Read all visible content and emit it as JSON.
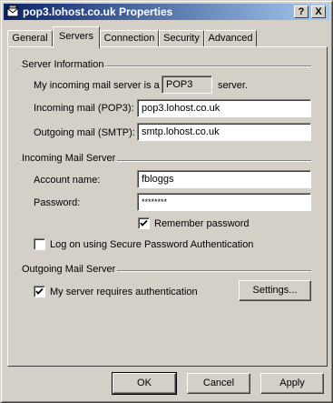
{
  "window": {
    "title": "pop3.lohost.co.uk Properties",
    "help_btn": "?",
    "close_btn": "X"
  },
  "tabs": [
    {
      "label": "General"
    },
    {
      "label": "Servers"
    },
    {
      "label": "Connection"
    },
    {
      "label": "Security"
    },
    {
      "label": "Advanced"
    }
  ],
  "server_info": {
    "heading": "Server Information",
    "incoming_type_prefix": "My incoming mail server is a",
    "incoming_type_value": "POP3",
    "incoming_type_suffix": "server.",
    "incoming_label": "Incoming mail (POP3):",
    "incoming_value": "pop3.lohost.co.uk",
    "outgoing_label": "Outgoing mail (SMTP):",
    "outgoing_value": "smtp.lohost.co.uk"
  },
  "incoming_server": {
    "heading": "Incoming Mail Server",
    "account_label": "Account name:",
    "account_value": "fbloggs",
    "password_label": "Password:",
    "password_value": "********",
    "remember_label": "Remember password",
    "remember_checked": true,
    "spa_label": "Log on using Secure Password Authentication",
    "spa_checked": false
  },
  "outgoing_server": {
    "heading": "Outgoing Mail Server",
    "auth_label": "My server requires authentication",
    "auth_checked": true,
    "settings_label": "Settings..."
  },
  "footer": {
    "ok_label": "OK",
    "cancel_label": "Cancel",
    "apply_label": "Apply"
  }
}
